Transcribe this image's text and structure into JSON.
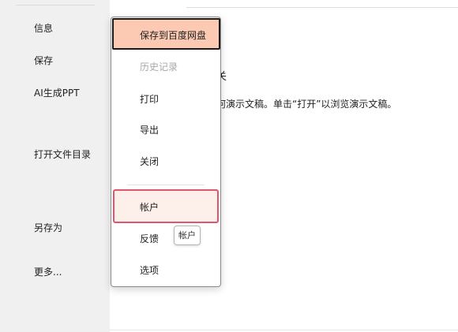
{
  "nav": {
    "items": [
      {
        "label": "信息"
      },
      {
        "label": "保存"
      },
      {
        "label": "AI生成PPT"
      },
      {
        "label": "打开文件目录"
      },
      {
        "label": "另存为"
      },
      {
        "label": "更多..."
      }
    ]
  },
  "main": {
    "heading_fragment": "关",
    "desc_fragment": "何演示文稿。单击“打开”以浏览演示文稿。"
  },
  "menu": {
    "items": [
      {
        "label": "保存到百度网盘",
        "state": "selected"
      },
      {
        "label": "历史记录",
        "state": "disabled"
      },
      {
        "label": "打印"
      },
      {
        "label": "导出"
      },
      {
        "label": "关闭"
      },
      {
        "label": "帐户",
        "state": "hover"
      },
      {
        "label": "反馈"
      },
      {
        "label": "选项"
      }
    ]
  },
  "tooltip": {
    "text": "帐户"
  },
  "colors": {
    "selected_bg": "#fcc9b3",
    "hover_border": "#e0576b",
    "hover_bg": "#fdefea"
  }
}
